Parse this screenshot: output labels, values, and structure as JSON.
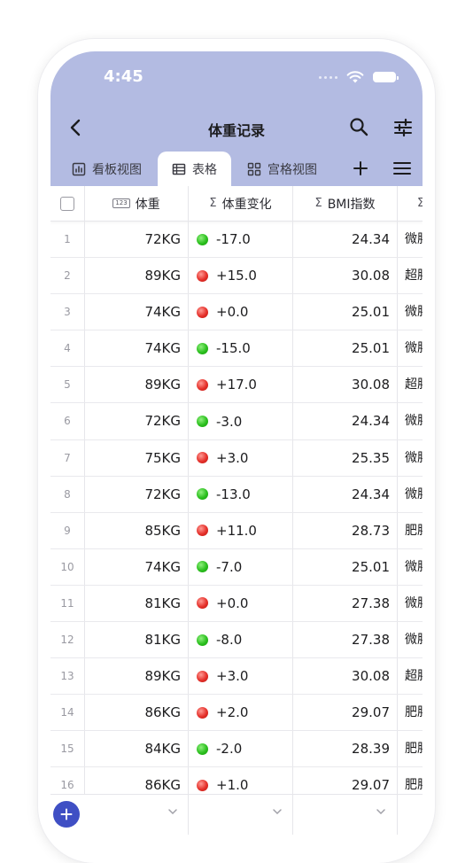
{
  "status": {
    "time": "4:45"
  },
  "nav": {
    "title": "体重记录"
  },
  "tabs": [
    {
      "label": "看板视图",
      "icon": "bar-chart-icon"
    },
    {
      "label": "表格",
      "icon": "table-icon",
      "active": true
    },
    {
      "label": "宫格视图",
      "icon": "grid-icon"
    }
  ],
  "columns": [
    {
      "label": "体重",
      "icon": "number-field-icon",
      "icon_text": "123"
    },
    {
      "label": "体重变化",
      "icon": "sigma-icon",
      "icon_text": "Σ"
    },
    {
      "label": "BMI指数",
      "icon": "sigma-icon",
      "icon_text": "Σ"
    },
    {
      "label": "",
      "icon": "sigma-icon",
      "icon_text": "Σ"
    }
  ],
  "rows": [
    {
      "index": "1",
      "weight": "72KG",
      "change": "-17.0",
      "trend": "green",
      "bmi": "24.34",
      "category": "微胖"
    },
    {
      "index": "2",
      "weight": "89KG",
      "change": "+15.0",
      "trend": "red",
      "bmi": "30.08",
      "category": "超胖"
    },
    {
      "index": "3",
      "weight": "74KG",
      "change": "+0.0",
      "trend": "red",
      "bmi": "25.01",
      "category": "微胖"
    },
    {
      "index": "4",
      "weight": "74KG",
      "change": "-15.0",
      "trend": "green",
      "bmi": "25.01",
      "category": "微胖"
    },
    {
      "index": "5",
      "weight": "89KG",
      "change": "+17.0",
      "trend": "red",
      "bmi": "30.08",
      "category": "超胖"
    },
    {
      "index": "6",
      "weight": "72KG",
      "change": "-3.0",
      "trend": "green",
      "bmi": "24.34",
      "category": "微胖"
    },
    {
      "index": "7",
      "weight": "75KG",
      "change": "+3.0",
      "trend": "red",
      "bmi": "25.35",
      "category": "微胖"
    },
    {
      "index": "8",
      "weight": "72KG",
      "change": "-13.0",
      "trend": "green",
      "bmi": "24.34",
      "category": "微胖"
    },
    {
      "index": "9",
      "weight": "85KG",
      "change": "+11.0",
      "trend": "red",
      "bmi": "28.73",
      "category": "肥胖"
    },
    {
      "index": "10",
      "weight": "74KG",
      "change": "-7.0",
      "trend": "green",
      "bmi": "25.01",
      "category": "微胖"
    },
    {
      "index": "11",
      "weight": "81KG",
      "change": "+0.0",
      "trend": "red",
      "bmi": "27.38",
      "category": "微胖"
    },
    {
      "index": "12",
      "weight": "81KG",
      "change": "-8.0",
      "trend": "green",
      "bmi": "27.38",
      "category": "微胖"
    },
    {
      "index": "13",
      "weight": "89KG",
      "change": "+3.0",
      "trend": "red",
      "bmi": "30.08",
      "category": "超胖"
    },
    {
      "index": "14",
      "weight": "86KG",
      "change": "+2.0",
      "trend": "red",
      "bmi": "29.07",
      "category": "肥胖"
    },
    {
      "index": "15",
      "weight": "84KG",
      "change": "-2.0",
      "trend": "green",
      "bmi": "28.39",
      "category": "肥胖"
    },
    {
      "index": "16",
      "weight": "86KG",
      "change": "+1.0",
      "trend": "red",
      "bmi": "29.07",
      "category": "肥胖"
    }
  ],
  "colors": {
    "header_bg": "#b3bbe2",
    "accent": "#3f4fc4",
    "dot_green": "#2bbf1e",
    "dot_red": "#e5302a"
  }
}
